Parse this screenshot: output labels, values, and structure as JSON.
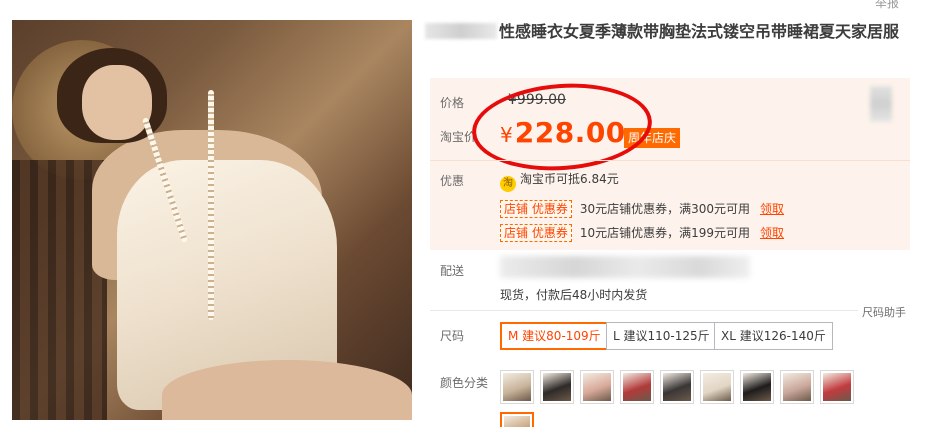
{
  "header": {
    "report_link": "举报"
  },
  "product": {
    "title_visible": "性感睡衣女夏季薄款带胸垫法式镂空吊带睡裙夏天家居服",
    "image_alt": "product-photo"
  },
  "price": {
    "label": "价格",
    "original": "¥999.00",
    "promo_label": "淘宝价",
    "currency": "¥",
    "promo_value": "228.00",
    "event_tag": "周年店庆"
  },
  "discount": {
    "label": "优惠",
    "coin_icon_char": "淘",
    "coin_text": "淘宝币可抵6.84元",
    "coupons": [
      {
        "tag": "店铺 优惠券",
        "text": "30元店铺优惠券，满300元可用",
        "action": "领取"
      },
      {
        "tag": "店铺 优惠券",
        "text": "10元店铺优惠券，满199元可用",
        "action": "领取"
      }
    ]
  },
  "delivery": {
    "label": "配送",
    "note": "现货，付款后48小时内发货"
  },
  "size": {
    "label": "尺码",
    "helper": "尺码助手",
    "options": [
      {
        "label": "M 建议80-109斤",
        "selected": true
      },
      {
        "label": "L 建议110-125斤",
        "selected": false
      },
      {
        "label": "XL 建议126-140斤",
        "selected": false
      }
    ]
  },
  "color": {
    "label": "颜色分类",
    "swatches": [
      "#c8b49a",
      "#2e2a28",
      "#d8a99a",
      "#b23a3a",
      "#3a3636",
      "#e2d6c4",
      "#1e1c1c",
      "#caa79a",
      "#c23b3f",
      "#c9a77e"
    ]
  },
  "colors": {
    "accent": "#ff4400",
    "tag": "#ff6a00",
    "box_bg": "#fef3ec",
    "highlight": "#e60c0c"
  }
}
